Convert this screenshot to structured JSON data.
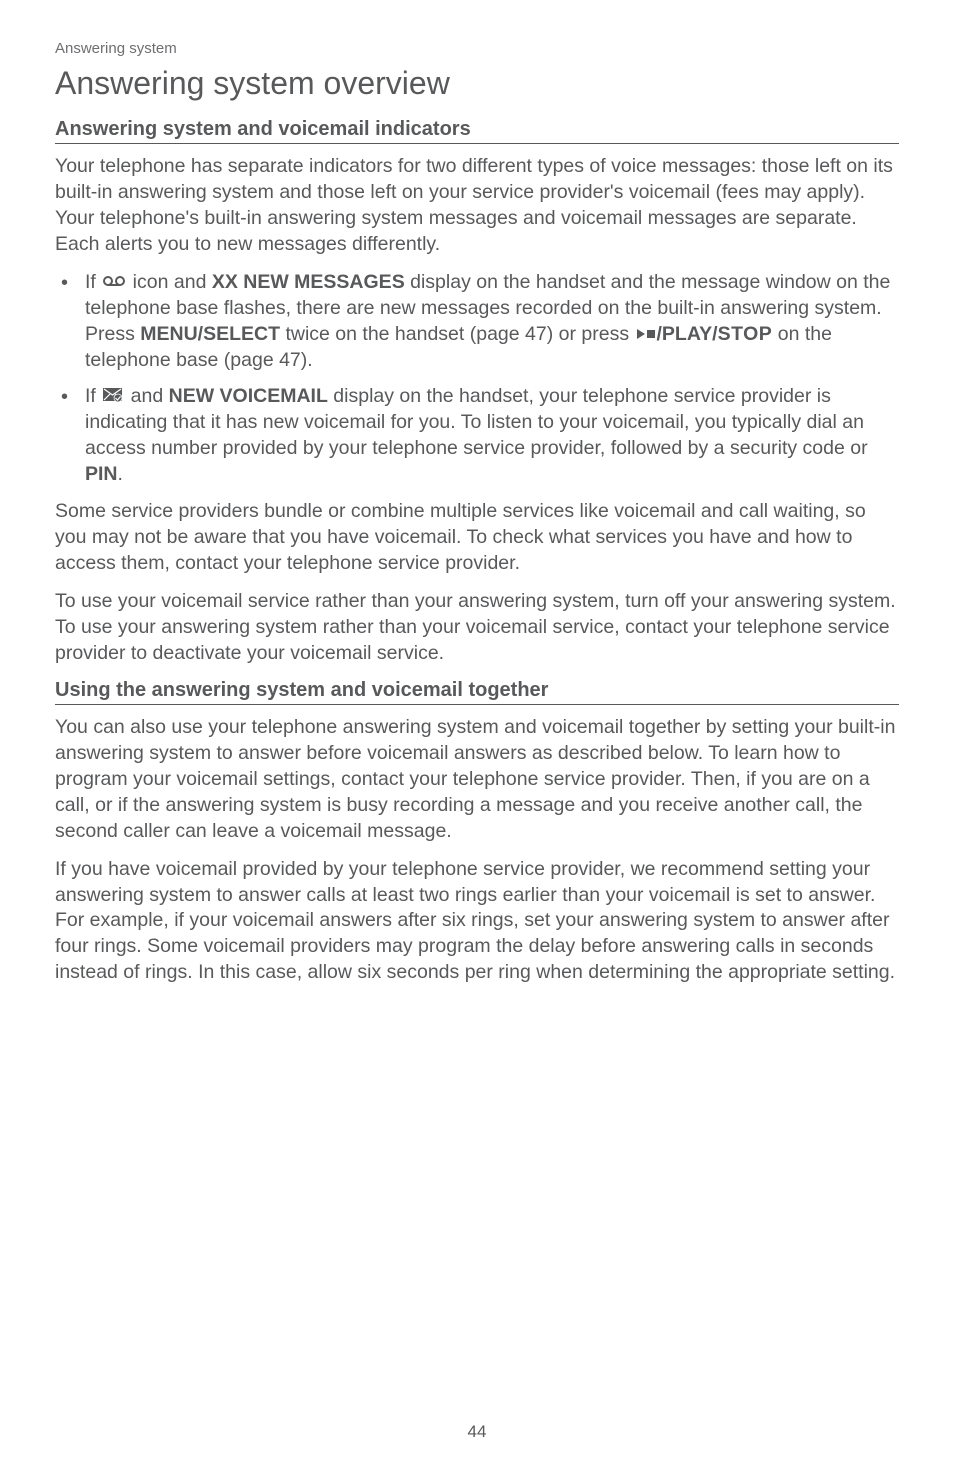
{
  "breadcrumb": "Answering system",
  "page_title": "Answering system overview",
  "section1": {
    "heading": "Answering system and voicemail indicators",
    "intro": "Your telephone has separate indicators for two different types of voice messages: those left on its built-in answering system and those left on your service provider's voicemail (fees may apply). Your telephone's built-in answering system messages and voicemail messages are separate. Each alerts you to new messages differently.",
    "bullet1": {
      "t1": "If ",
      "t2": " icon and ",
      "bold1": "XX NEW MESSAGES",
      "t3": " display on the handset and the message window on the telephone base flashes, there are new messages recorded on the built-in answering system. Press ",
      "bold2": "MENU/SELECT",
      "t4": " twice on the handset (page 47) or press ",
      "bold3a": "/PLAY/",
      "bold3b": "STOP",
      "t5": " on the telephone base (page 47)."
    },
    "bullet2": {
      "t1": "If ",
      "t2": " and ",
      "bold1": "NEW VOICEMAIL",
      "t3": " display on the handset, your telephone service provider is indicating that it has new voicemail for you. To listen to your voicemail, you typically dial an access number provided by your telephone service provider, followed by a security code or ",
      "bold2": "PIN",
      "t4": "."
    },
    "para2": "Some service providers bundle or combine multiple services like voicemail and call waiting, so you may not be aware that you have voicemail. To check what services you have and how to access them, contact your telephone service provider.",
    "para3": "To use your voicemail service rather than your answering system, turn off your answering system. To use your answering system rather than your voicemail service, contact your telephone service provider to deactivate your voicemail service."
  },
  "section2": {
    "heading": "Using the answering system and voicemail together",
    "para1": "You can also use your telephone answering system and voicemail together by setting your built-in answering system to answer before voicemail answers as described below. To learn how to program your voicemail settings, contact your telephone service provider. Then, if you are on a call, or if the answering system is busy recording a message and you receive another call, the second caller can leave a voicemail message.",
    "para2": "If you have voicemail provided by your telephone service provider, we recommend setting your answering system to answer calls at least two rings earlier than your voicemail is set to answer. For example, if your voicemail answers after six rings, set your answering system to answer after four rings. Some voicemail providers may program the delay before answering calls in seconds instead of rings. In this case, allow six seconds per ring when determining the appropriate setting."
  },
  "page_number": "44"
}
